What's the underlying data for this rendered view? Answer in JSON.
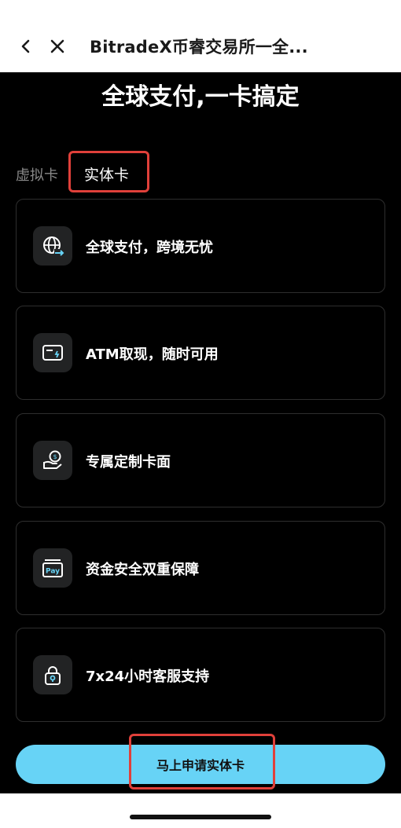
{
  "header": {
    "title": "BitradeX币睿交易所一全..."
  },
  "hero": {
    "title": "全球支付,一卡搞定"
  },
  "tabs": [
    {
      "label": "虚拟卡",
      "active": false
    },
    {
      "label": "实体卡",
      "active": true
    }
  ],
  "features": [
    {
      "label": "全球支付，跨境无忧",
      "icon": "globe-transfer-icon"
    },
    {
      "label": "ATM取现，随时可用",
      "icon": "atm-card-icon"
    },
    {
      "label": "专属定制卡面",
      "icon": "custom-card-icon"
    },
    {
      "label": "资金安全双重保障",
      "icon": "pay-wallet-icon"
    },
    {
      "label": "7x24小时客服支持",
      "icon": "lock-icon"
    }
  ],
  "cta": {
    "label": "马上申请实体卡"
  },
  "colors": {
    "accent": "#67d3f6",
    "highlight": "#e0403a",
    "background": "#000000",
    "card_border": "#2e2e2e"
  }
}
